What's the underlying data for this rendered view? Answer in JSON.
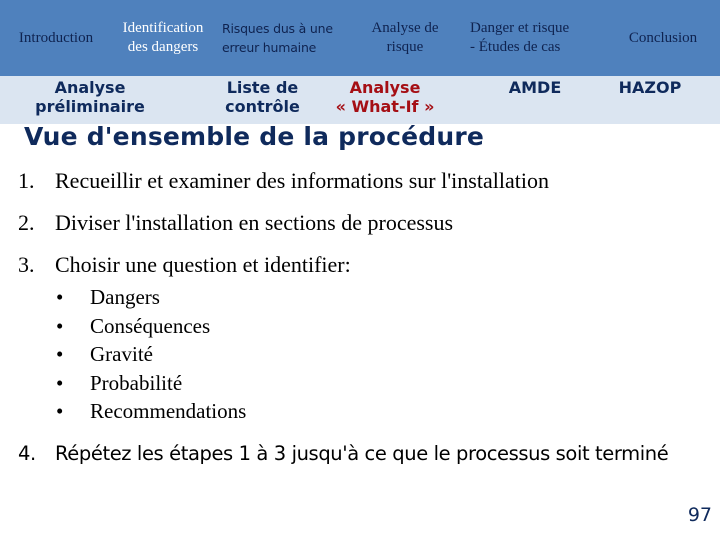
{
  "top_nav": {
    "items": [
      {
        "line1": "Introduction",
        "line2": ""
      },
      {
        "line1": "Identification",
        "line2": "des dangers"
      },
      {
        "line1": "Risques dus à une",
        "line2": "erreur humaine"
      },
      {
        "line1": "Analyse de",
        "line2": "risque"
      },
      {
        "line1": "Danger et risque",
        "line2": "- Études de cas"
      },
      {
        "line1": "Conclusion",
        "line2": ""
      }
    ],
    "active_index": 1
  },
  "sub_nav": {
    "items": [
      {
        "line1": "Analyse",
        "line2": "préliminaire"
      },
      {
        "line1": "Liste de",
        "line2": "contrôle"
      },
      {
        "line1": "Analyse",
        "line2": "« What-If »"
      },
      {
        "line1": "AMDE",
        "line2": ""
      },
      {
        "line1": "HAZOP",
        "line2": ""
      }
    ],
    "active_index": 2
  },
  "slide": {
    "title": "Vue d'ensemble de la procédure",
    "steps": [
      {
        "num": "1.",
        "text": "Recueillir et examiner des informations sur l'installation"
      },
      {
        "num": "2.",
        "text": "Diviser l'installation en sections de processus"
      },
      {
        "num": "3.",
        "text": "Choisir une question et identifier:"
      }
    ],
    "bullet_glyph": "•",
    "bullets": [
      "Dangers",
      "Conséquences",
      "Gravité",
      "Probabilité",
      "Recommendations"
    ],
    "step4": {
      "num": "4.",
      "text": "Répétez les étapes 1  à 3 jusqu'à ce que le processus soit terminé"
    },
    "page_number": "97"
  },
  "colors": {
    "top_nav_bg": "#4f81bd",
    "sub_nav_bg": "#dbe5f1",
    "nav_text": "#0f2350",
    "active_top": "#ffffff",
    "active_sub": "#a50f15",
    "title": "#0f2a5c"
  }
}
